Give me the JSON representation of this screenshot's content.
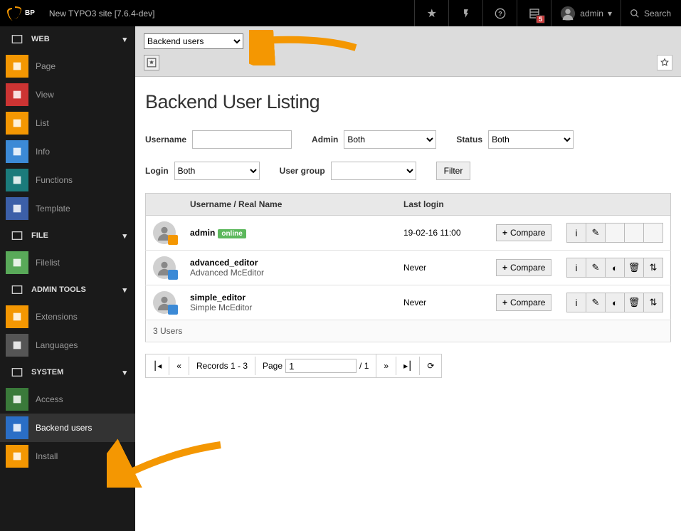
{
  "topbar": {
    "site_title": "New TYPO3 site [7.6.4-dev]",
    "badge_count": "5",
    "user_label": "admin",
    "search_label": "Search"
  },
  "sidebar": {
    "groups": [
      {
        "label": "WEB",
        "items": [
          {
            "label": "Page",
            "color": "#f49702"
          },
          {
            "label": "View",
            "color": "#cc3433"
          },
          {
            "label": "List",
            "color": "#f49702"
          },
          {
            "label": "Info",
            "color": "#3c8ad6"
          },
          {
            "label": "Functions",
            "color": "#1b7b7b"
          },
          {
            "label": "Template",
            "color": "#3c5fa8"
          }
        ]
      },
      {
        "label": "FILE",
        "items": [
          {
            "label": "Filelist",
            "color": "#59a959"
          }
        ]
      },
      {
        "label": "ADMIN TOOLS",
        "items": [
          {
            "label": "Extensions",
            "color": "#f49702"
          },
          {
            "label": "Languages",
            "color": "#555"
          }
        ]
      },
      {
        "label": "SYSTEM",
        "items": [
          {
            "label": "Access",
            "color": "#3a7a3a"
          },
          {
            "label": "Backend users",
            "color": "#2a6ec6",
            "active": true
          },
          {
            "label": "Install",
            "color": "#f49702"
          }
        ]
      }
    ]
  },
  "content": {
    "module_select": "Backend users",
    "title": "Backend User Listing",
    "filters": {
      "username_label": "Username",
      "admin_label": "Admin",
      "admin_val": "Both",
      "status_label": "Status",
      "status_val": "Both",
      "login_label": "Login",
      "login_val": "Both",
      "usergroup_label": "User group",
      "usergroup_val": "",
      "filter_btn": "Filter"
    },
    "table": {
      "col_user": "Username / Real Name",
      "col_login": "Last login",
      "rows": [
        {
          "username": "admin",
          "realname": "",
          "online": "online",
          "last": "19-02-16 11:00",
          "admin": true
        },
        {
          "username": "advanced_editor",
          "realname": "Advanced McEditor",
          "last": "Never",
          "admin": false
        },
        {
          "username": "simple_editor",
          "realname": "Simple McEditor",
          "last": "Never",
          "admin": false
        }
      ],
      "compare_label": "Compare",
      "footer": "3 Users"
    },
    "pagination": {
      "records": "Records 1 - 3",
      "page_label": "Page",
      "page_val": "1",
      "of": "/ 1"
    }
  }
}
